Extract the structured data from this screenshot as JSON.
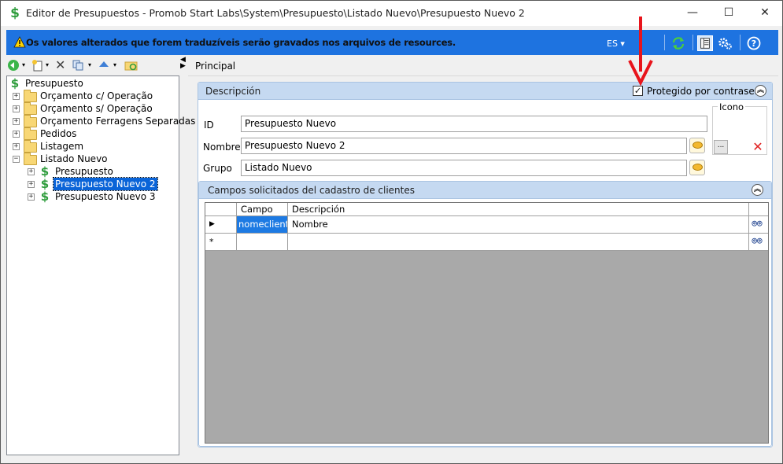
{
  "window": {
    "title": "Editor de Presupuestos - Promob Start Labs\\System\\Presupuesto\\Listado Nuevo\\Presupuesto Nuevo 2",
    "minimize": "—",
    "maximize": "☐",
    "close": "✕"
  },
  "infobar": {
    "message": "Os valores alterados que forem traduzíveis serão gravados nos arquivos de resources.",
    "language": "ES ▾",
    "color": "#1e73e0"
  },
  "left_toolbar": {
    "icons": [
      "back-icon",
      "new-icon",
      "delete-icon",
      "copy-icon",
      "move-up-icon",
      "refresh-folder-icon"
    ]
  },
  "tree": {
    "root": "Presupuesto",
    "items": [
      {
        "label": "Orçamento c/ Operação",
        "type": "folder"
      },
      {
        "label": "Orçamento s/ Operação",
        "type": "folder"
      },
      {
        "label": "Orçamento Ferragens Separadas",
        "type": "folder"
      },
      {
        "label": "Pedidos",
        "type": "folder"
      },
      {
        "label": "Listagem",
        "type": "folder"
      },
      {
        "label": "Listado Nuevo",
        "type": "folder"
      }
    ],
    "children": [
      {
        "label": "Presupuesto"
      },
      {
        "label": "Presupuesto Nuevo 2",
        "selected": true
      },
      {
        "label": "Presupuesto Nuevo 3"
      }
    ]
  },
  "main": {
    "tab": "Principal",
    "description_group": {
      "title": "Descripción",
      "protected_label": "Protegido por contraseña",
      "protected_checked": true,
      "id_label": "ID",
      "id_value": "Presupuesto Nuevo",
      "name_label": "Nombre",
      "name_value": "Presupuesto Nuevo 2",
      "group_label": "Grupo",
      "group_value": "Listado Nuevo",
      "icon_label": "Icono",
      "browse_label": "..."
    },
    "fields_group": {
      "title": "Campos solicitados del cadastro de clientes",
      "columns": [
        "Campo",
        "Descripción"
      ],
      "rows": [
        {
          "indicator": "▶",
          "campo": "nomecliente",
          "descripcion": "Nombre"
        },
        {
          "indicator": "*",
          "campo": "",
          "descripcion": ""
        }
      ]
    }
  }
}
